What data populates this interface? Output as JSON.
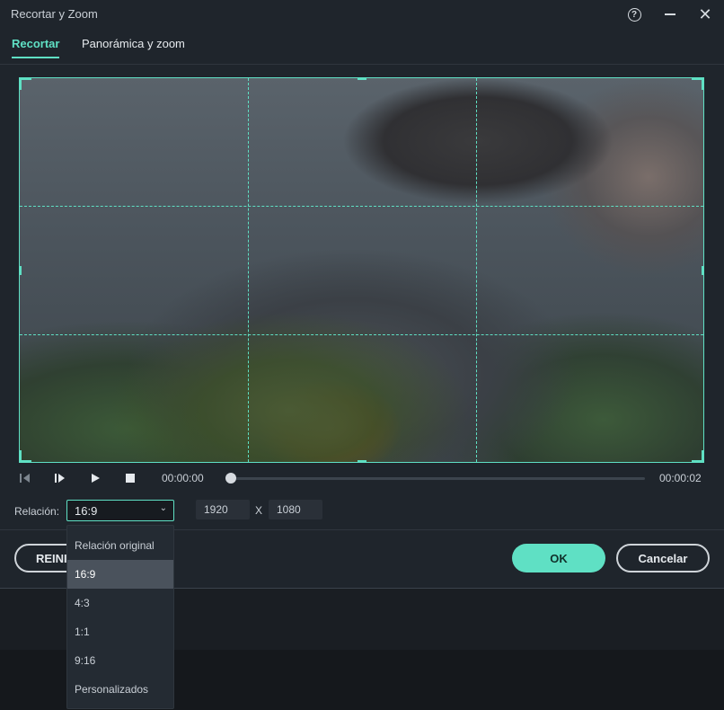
{
  "window": {
    "title": "Recortar y Zoom"
  },
  "tabs": [
    {
      "label": "Recortar",
      "active": true
    },
    {
      "label": "Panorámica y zoom",
      "active": false
    }
  ],
  "player": {
    "current_time": "00:00:00",
    "total_time": "00:00:02",
    "progress": 0
  },
  "ratio": {
    "label": "Relación:",
    "selected": "16:9",
    "options": [
      "Relación original",
      "16:9",
      "4:3",
      "1:1",
      "9:16",
      "Personalizados"
    ],
    "width": "1920",
    "separator": "X",
    "height": "1080"
  },
  "buttons": {
    "reset": "REINI",
    "ok": "OK",
    "cancel": "Cancelar"
  },
  "colors": {
    "accent": "#5fe0c4",
    "background": "#1f252c"
  }
}
